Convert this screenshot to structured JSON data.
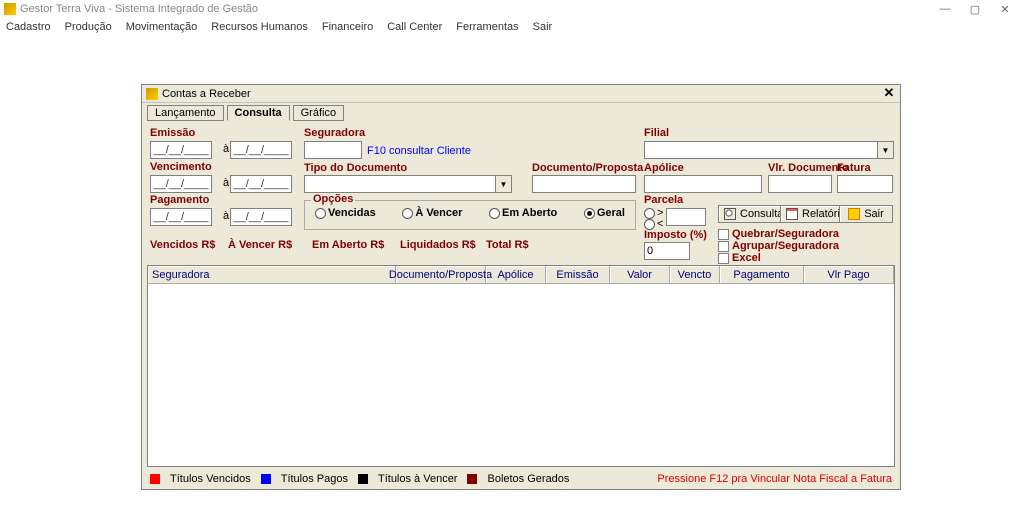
{
  "app": {
    "title": "Gestor Terra Viva - Sistema Integrado de Gestão",
    "window_min": "—",
    "window_max": "▢",
    "window_close": "✕",
    "menubar": [
      "Cadastro",
      "Produção",
      "Movimentação",
      "Recursos Humanos",
      "Financeiro",
      "Call Center",
      "Ferramentas",
      "Sair"
    ]
  },
  "win": {
    "title": "Contas a Receber",
    "close": "✕",
    "tabs": {
      "lanc": "Lançamento",
      "cons": "Consulta",
      "graf": "Gráfico"
    }
  },
  "labels": {
    "emissao": "Emissão",
    "vencimento": "Vencimento",
    "pagamento": "Pagamento",
    "ate": "à",
    "seguradora": "Seguradora",
    "f10": "F10 consultar Cliente",
    "tipo_doc": "Tipo do Documento",
    "doc_proposta": "Documento/Proposta",
    "filial": "Filial",
    "apolice": "Apólice",
    "vlr_doc": "Vlr. Documento",
    "fatura": "Fatura",
    "parcela": "Parcela",
    "imposto": "Imposto (%)",
    "parc_maior": ">",
    "parc_menor": "<"
  },
  "dates": {
    "mask": "__/__/____"
  },
  "opcoes": {
    "title": "Opções",
    "vencidas": "Vencidas",
    "a_vencer": "À Vencer",
    "em_aberto": "Em Aberto",
    "geral": "Geral"
  },
  "sums": {
    "vencidos": "Vencidos R$",
    "a_vencer": "À Vencer R$",
    "em_aberto": "Em Aberto R$",
    "liquidados": "Liquidados R$",
    "total": "Total R$"
  },
  "btns": {
    "consultar": "Consultar",
    "relatorio": "Relatório",
    "sair": "Sair"
  },
  "chks": {
    "quebrar": "Quebrar/Seguradora",
    "agrupar": "Agrupar/Seguradora",
    "excel": "Excel"
  },
  "imposto_val": "0",
  "parcela_val": "",
  "grid": {
    "cols": {
      "seguradora": "Seguradora",
      "doc_proposta": "Documento/Proposta",
      "apolice": "Apólice",
      "emissao": "Emissão",
      "valor": "Valor",
      "vencto": "Vencto",
      "pagamento": "Pagamento",
      "vlr_pago": "Vlr Pago"
    }
  },
  "legend": {
    "vencidos": "Títulos Vencidos",
    "pagos": "Títulos Pagos",
    "a_vencer": "Títulos à Vencer",
    "boletos": "Boletos Gerados",
    "f12": "Pressione F12 pra Vincular Nota Fiscal a Fatura"
  }
}
